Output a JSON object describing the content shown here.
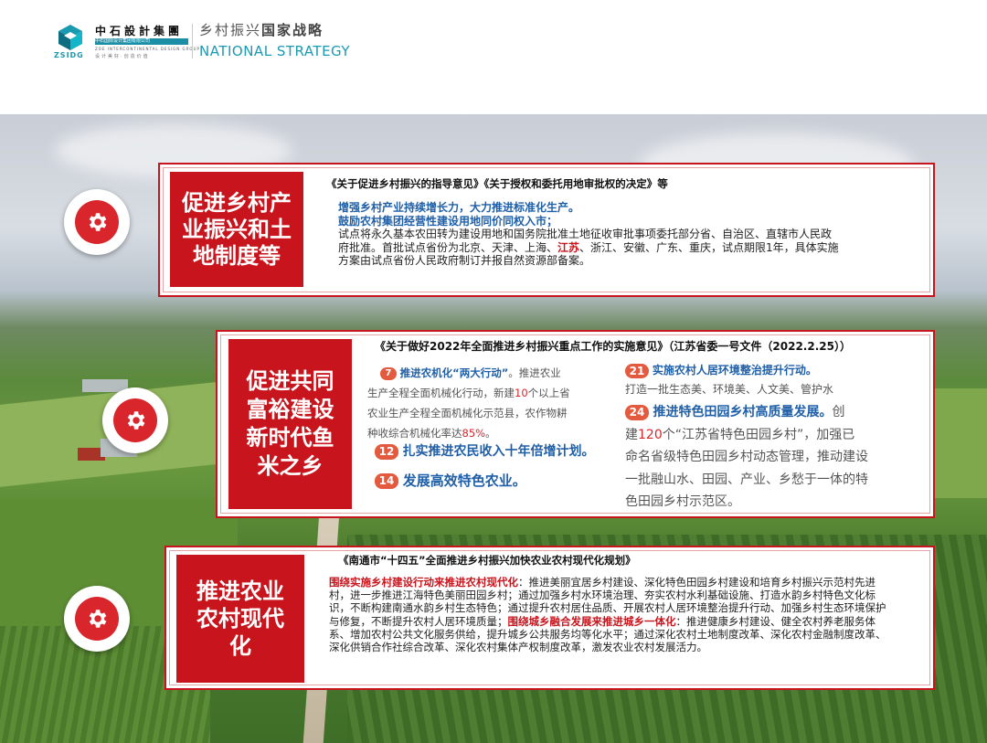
{
  "header": {
    "logo_name": "中石設計集團",
    "logo_sub1": "中石国际设计集团有限公司",
    "logo_sub2": "ZOE INTERCONTINENTAL DESIGN GROUP",
    "logo_abbr": "ZSIDG",
    "logo_slogan": "设计美好·创造价值",
    "title_light": "乡村振兴",
    "title_bold": "国家战略",
    "title_en": "NATIONAL STRATEGY"
  },
  "panel1": {
    "label_lines": [
      "促进乡村产",
      "业振兴和土",
      "地制度等"
    ],
    "doc_title": "《关于促进乡村振兴的指导意见》《关于授权和委托用地审批权的决定》等",
    "blue_line1": "增强乡村产业持续增长力，大力推进标准化生产。",
    "blue_line2": "鼓励农村集团经营性建设用地同价同权入市；",
    "body_a": "试点将永久基本农田转为建设用地和国务院批准土地征收审批事项委托部分省、自治区、直辖市人民政府批准。首批试点省份为北京、天津、上海、",
    "body_red": "江苏",
    "body_b": "、浙江、安徽、广东、重庆，试点期限1年，具体实施方案由试点省份人民政府制订并报自然资源部备案。"
  },
  "panel2": {
    "label_lines": [
      "促进共同",
      "富裕建设",
      "新时代鱼",
      "米之乡"
    ],
    "doc_title": "《关于做好2022年全面推进乡村振兴重点工作的实施意见》（江苏省委一号文件（2022.2.25））",
    "item7_num": "7",
    "item7_title": "推进农机化“两大行动”",
    "item7_text_a": "。推进农业",
    "item7_text_b": "生产全程全面机械化行动，新建",
    "item7_num10": "10",
    "item7_text_c": "个以上省",
    "item7_text_d": "农业生产全程全面机械化示范县，农作物耕",
    "item7_text_e": "种收综合机械化率达",
    "item7_pct": "85%",
    "item7_text_f": "。",
    "item12_num": "12",
    "item12_title": "扎实推进农民收入十年倍增计划。",
    "item14_num": "14",
    "item14_title": "发展高效特色农业。",
    "item21_num": "21",
    "item21_title": "实施农村人居环境整治提升行动。",
    "item21_text": "打造一批生态美、环境美、人文美、管护水",
    "item24_num": "24",
    "item24_title": "推进特色田园乡村高质量发展。",
    "item24_a": "创",
    "item24_b1": "建",
    "item24_num120": "120",
    "item24_b2": "个“江苏省特色田园乡村”，加强已",
    "item24_c": "命名省级特色田园乡村动态管理，推动建设",
    "item24_d": "一批融山水、田园、产业、乡愁于一体的特",
    "item24_e": "色田园乡村示范区。"
  },
  "panel3": {
    "label_lines": [
      "推进农业",
      "农村现代",
      "化"
    ],
    "doc_title": "《南通市“十四五”全面推进乡村振兴加快农业农村现代化规划》",
    "red1": "围绕实施乡村建设行动来推进农村现代化",
    "body1": "：推进美丽宜居乡村建设、深化特色田园乡村建设和培育乡村振兴示范村先进村，进一步推进江海特色美丽田园乡村；通过加强乡村水环境治理、夯实农村水利基础设施、打造水韵乡村特色文化标识，不断构建南通水韵乡村生态特色；通过提升农村居住品质、开展农村人居环境整治提升行动、加强乡村生态环境保护与修复，不断提升农村人居环境质量；",
    "red2": "围绕城乡融合发展来推进城乡一体化",
    "body2": "：推进健康乡村建设、健全农村养老服务体系、增加农村公共文化服务供给，提升城乡公共服务均等化水平；通过深化农村土地制度改革、深化农村金融制度改革、深化供销合作社综合改革、深化农村集体产权制度改革，激发农业农村发展活力。"
  },
  "colors": {
    "accent_red": "#c8141c",
    "accent_blue": "#1f5fa8",
    "teal": "#1a9ab0"
  },
  "icons": [
    "gear-icon"
  ]
}
